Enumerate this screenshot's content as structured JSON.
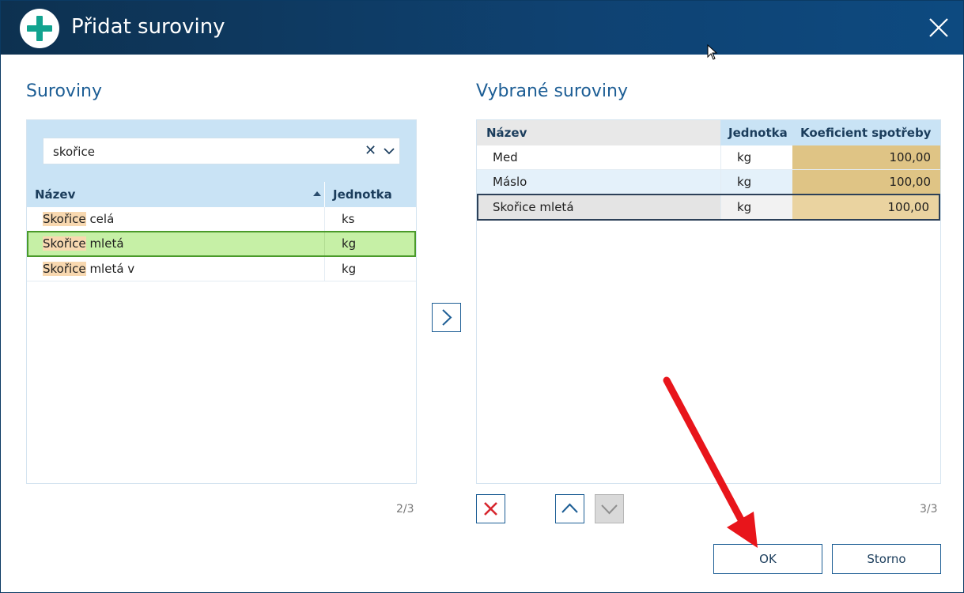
{
  "window": {
    "title": "Přidat suroviny",
    "title_icon": "plus-circle-icon",
    "close_icon": "close-icon"
  },
  "left": {
    "heading": "Suroviny",
    "search": {
      "value": "skořice",
      "clear_icon": "clear-icon",
      "dropdown_icon": "chevron-down-icon"
    },
    "columns": {
      "name": "Název",
      "unit": "Jednotka"
    },
    "rows": [
      {
        "highlight": "Skořice",
        "rest": " celá",
        "unit": "ks"
      },
      {
        "highlight": "Skořice",
        "rest": " mletá",
        "unit": "kg"
      },
      {
        "highlight": "Skořice",
        "rest": " mletá v",
        "unit": "kg"
      }
    ],
    "counter": "2/3"
  },
  "transfer_icon": "chevron-right-icon",
  "right": {
    "heading": "Vybrané suroviny",
    "columns": {
      "name": "Název",
      "unit": "Jednotka",
      "coef": "Koeficient spotřeby"
    },
    "rows": [
      {
        "name": "Med",
        "unit": "kg",
        "coef": "100,00"
      },
      {
        "name": "Máslo",
        "unit": "kg",
        "coef": "100,00"
      },
      {
        "name": "Skořice mletá",
        "unit": "kg",
        "coef": "100,00"
      }
    ],
    "counter": "3/3"
  },
  "buttons": {
    "ok": "OK",
    "cancel": "Storno"
  },
  "colors": {
    "titlebar": "#0f4272",
    "accent": "#1d5e95",
    "plus": "#12a38f",
    "selected_row": "#c6f0a6",
    "coef_cell": "#dfc485",
    "delete_red": "#d7262e",
    "annotation": "#e8151b"
  }
}
